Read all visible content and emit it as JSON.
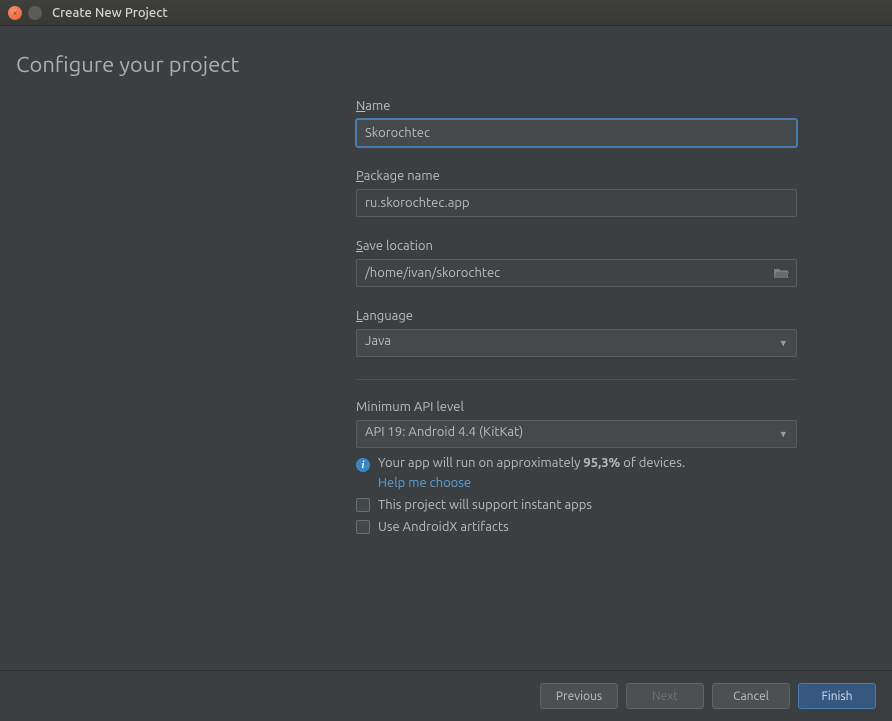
{
  "window": {
    "title": "Create New Project"
  },
  "heading": "Configure your project",
  "fields": {
    "name": {
      "label": "Name",
      "value": "Skorochtec"
    },
    "package": {
      "label": "Package name",
      "value": "ru.skorochtec.app"
    },
    "saveLocation": {
      "label": "Save location",
      "value": "/home/ivan/skorochtec"
    },
    "language": {
      "label": "Language",
      "value": "Java"
    },
    "minApi": {
      "label": "Minimum API level",
      "value": "API 19: Android 4.4 (KitKat)"
    }
  },
  "info": {
    "prefix": "Your app will run on approximately ",
    "percent": "95,3%",
    "suffix": " of devices.",
    "helpLink": "Help me choose"
  },
  "checkboxes": {
    "instantApps": "This project will support instant apps",
    "androidx": "Use AndroidX artifacts"
  },
  "buttons": {
    "previous": "Previous",
    "next": "Next",
    "cancel": "Cancel",
    "finish": "Finish"
  }
}
